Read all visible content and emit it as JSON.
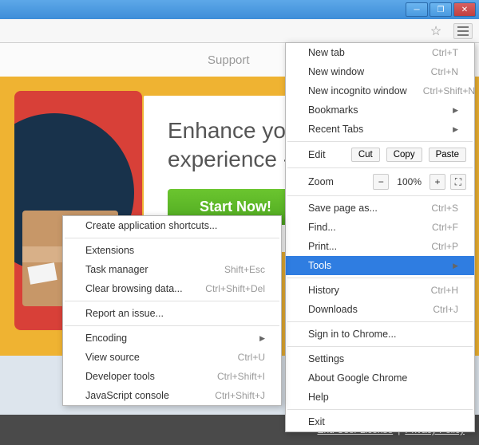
{
  "nav": {
    "support": "Support"
  },
  "hero": {
    "line1": "Enhance your bro",
    "line2": "experience - Brow",
    "cta": "Start Now!"
  },
  "mainmenu": {
    "newtab": "New tab",
    "newtab_sc": "Ctrl+T",
    "newwin": "New window",
    "newwin_sc": "Ctrl+N",
    "incog": "New incognito window",
    "incog_sc": "Ctrl+Shift+N",
    "bookmarks": "Bookmarks",
    "recent": "Recent Tabs",
    "edit": "Edit",
    "cut": "Cut",
    "copy": "Copy",
    "paste": "Paste",
    "zoom": "Zoom",
    "zoomval": "100%",
    "saveas": "Save page as...",
    "saveas_sc": "Ctrl+S",
    "find": "Find...",
    "find_sc": "Ctrl+F",
    "print": "Print...",
    "print_sc": "Ctrl+P",
    "tools": "Tools",
    "history": "History",
    "history_sc": "Ctrl+H",
    "downloads": "Downloads",
    "downloads_sc": "Ctrl+J",
    "signin": "Sign in to Chrome...",
    "settings": "Settings",
    "about": "About Google Chrome",
    "help": "Help",
    "exit": "Exit"
  },
  "submenu": {
    "shortcuts": "Create application shortcuts...",
    "extensions": "Extensions",
    "taskmgr": "Task manager",
    "taskmgr_sc": "Shift+Esc",
    "clear": "Clear browsing data...",
    "clear_sc": "Ctrl+Shift+Del",
    "report": "Report an issue...",
    "encoding": "Encoding",
    "viewsrc": "View source",
    "viewsrc_sc": "Ctrl+U",
    "devtools": "Developer tools",
    "devtools_sc": "Ctrl+Shift+I",
    "jsconsole": "JavaScript console",
    "jsconsole_sc": "Ctrl+Shift+J"
  },
  "footer": {
    "eula": "End User License",
    "sep": "|",
    "privacy": "Privacy Policy"
  }
}
